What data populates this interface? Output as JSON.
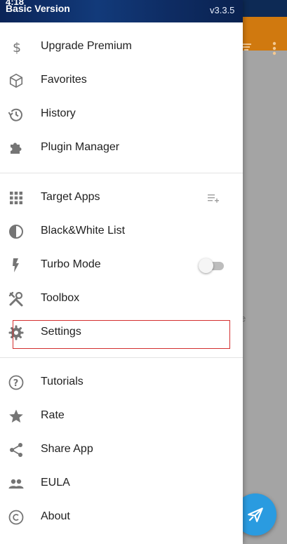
{
  "status_bar": {
    "time": "4:18"
  },
  "header": {
    "title": "Basic Version",
    "version": "v3.3.5"
  },
  "menu_groups": [
    [
      {
        "label": "Upgrade Premium",
        "icon": "dollar-icon"
      },
      {
        "label": "Favorites",
        "icon": "cube-icon"
      },
      {
        "label": "History",
        "icon": "history-icon"
      },
      {
        "label": "Plugin Manager",
        "icon": "puzzle-icon"
      }
    ],
    [
      {
        "label": "Target Apps",
        "icon": "grid-icon"
      },
      {
        "label": "Black&White List",
        "icon": "contrast-icon"
      },
      {
        "label": "Turbo Mode",
        "icon": "flash-icon"
      },
      {
        "label": "Toolbox",
        "icon": "tools-icon"
      },
      {
        "label": "Settings",
        "icon": "gear-icon"
      }
    ],
    [
      {
        "label": "Tutorials",
        "icon": "help-icon"
      },
      {
        "label": "Rate",
        "icon": "star-icon"
      },
      {
        "label": "Share App",
        "icon": "share-icon"
      },
      {
        "label": "EULA",
        "icon": "people-icon"
      },
      {
        "label": "About",
        "icon": "copyright-icon"
      }
    ]
  ],
  "turbo_mode": {
    "enabled": false
  },
  "background_app": {
    "hint_fragment": "e"
  },
  "colors": {
    "accent": "#d0790f",
    "icon": "#757575",
    "header": "#0b2457",
    "fab": "#2a9be0",
    "highlight": "#d32f2f"
  }
}
